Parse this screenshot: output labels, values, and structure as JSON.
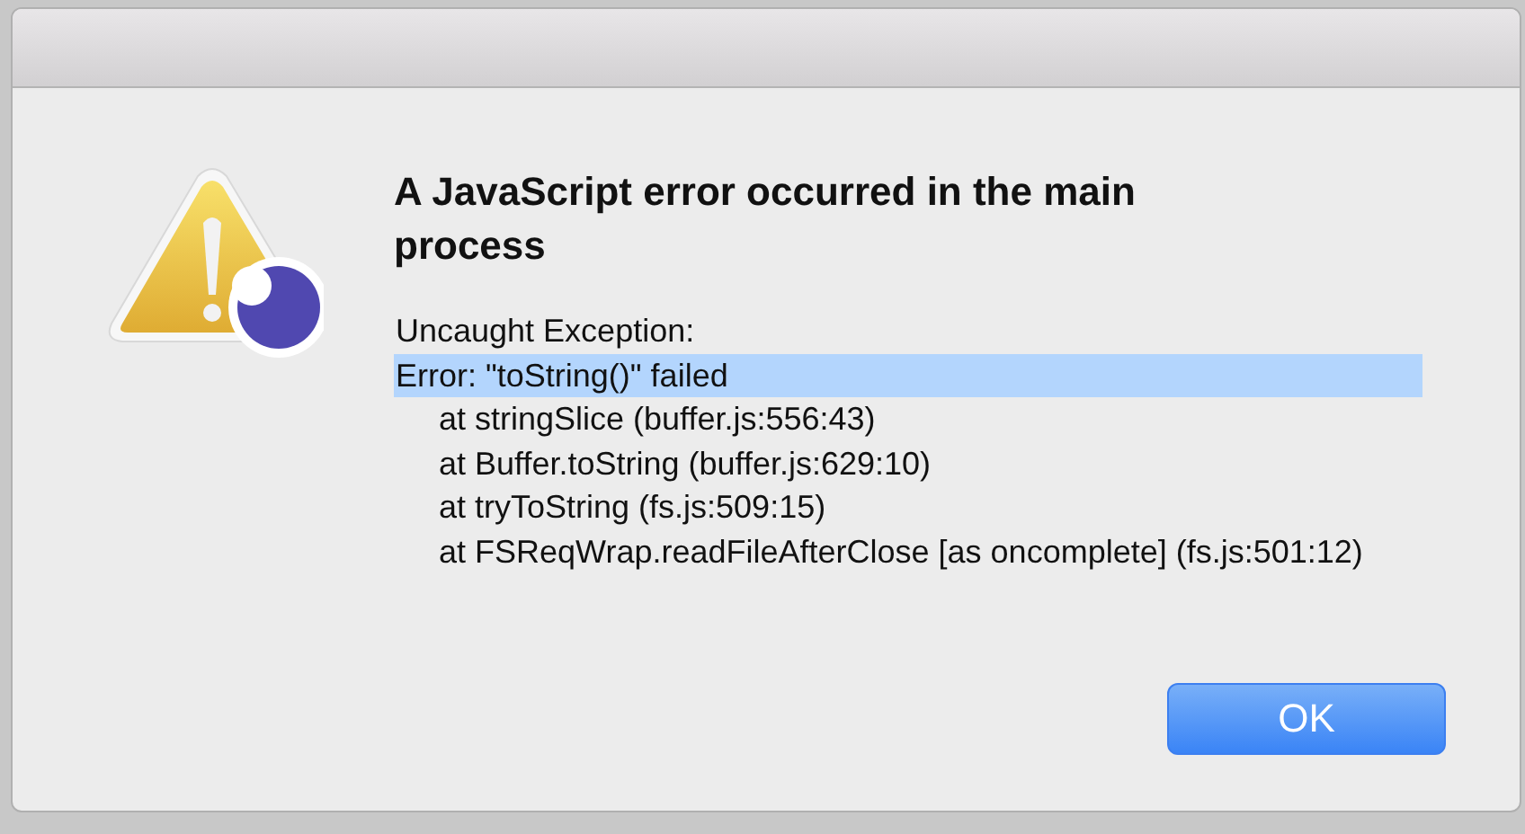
{
  "dialog": {
    "title": "A JavaScript error occurred in the main process",
    "exception_label": "Uncaught Exception:",
    "error_line": {
      "text": "Error: \"toString()\" failed",
      "selected": true
    },
    "stack_frames": [
      "at stringSlice (buffer.js:556:43)",
      "at Buffer.toString (buffer.js:629:10)",
      "at tryToString (fs.js:509:15)",
      "at FSReqWrap.readFileAfterClose [as oncomplete] (fs.js:501:12)"
    ],
    "buttons": [
      {
        "label": "OK",
        "kind": "default"
      }
    ]
  }
}
